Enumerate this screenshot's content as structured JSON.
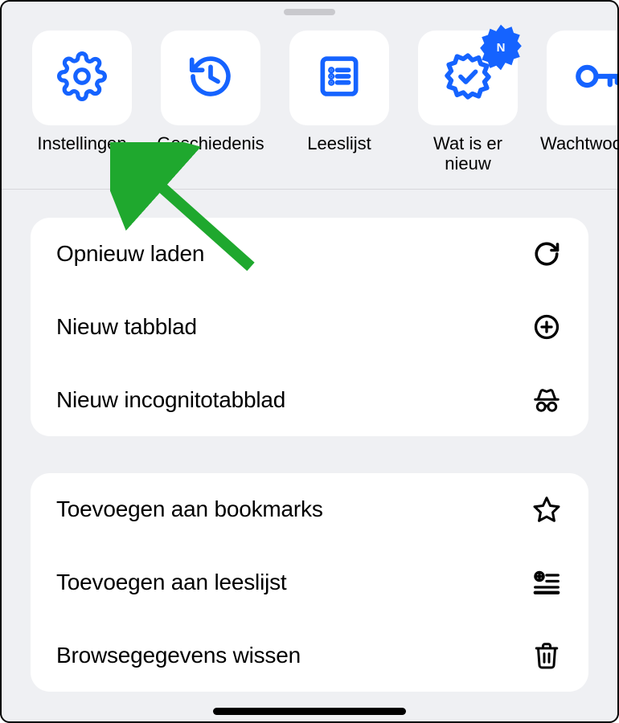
{
  "accent": "#1563ff",
  "shortcuts": [
    {
      "id": "settings",
      "label": "Instellingen"
    },
    {
      "id": "history",
      "label": "Geschiedenis"
    },
    {
      "id": "readlist",
      "label": "Leeslijst"
    },
    {
      "id": "whatsnew",
      "label": "Wat is er nieuw",
      "badge": "N"
    },
    {
      "id": "pwmanager",
      "label": "Wachtwoordmanag…"
    }
  ],
  "menu": {
    "group1": [
      {
        "id": "reload",
        "label": "Opnieuw laden"
      },
      {
        "id": "newtab",
        "label": "Nieuw tabblad"
      },
      {
        "id": "incognito",
        "label": "Nieuw incognitotabblad"
      }
    ],
    "group2": [
      {
        "id": "addbookmark",
        "label": "Toevoegen aan bookmarks"
      },
      {
        "id": "addreadlist",
        "label": "Toevoegen aan leeslijst"
      },
      {
        "id": "cleardata",
        "label": "Browsegegevens wissen"
      }
    ]
  }
}
